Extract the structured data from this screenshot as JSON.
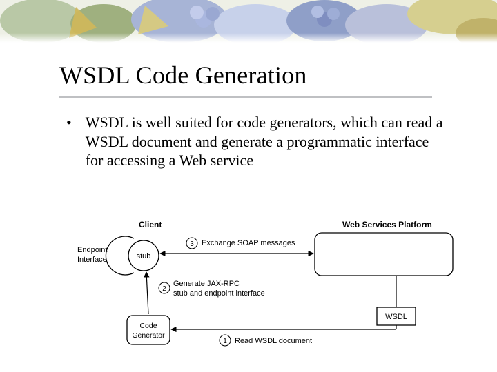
{
  "slide": {
    "title": "WSDL Code Generation",
    "bullet": "WSDL is well suited for code generators, which can read a WSDL document and generate a programmatic interface for accessing a Web service"
  },
  "diagram": {
    "client_label": "Client",
    "platform_label": "Web Services Platform",
    "endpoint_interface": "Endpoint\nInterface",
    "stub_label": "stub",
    "code_generator": "Code\nGenerator",
    "wsdl_box": "WSDL",
    "step1": "Read WSDL document",
    "step2": "Generate JAX-RPC\nstub and endpoint interface",
    "step3": "Exchange SOAP messages",
    "num1": "1",
    "num2": "2",
    "num3": "3"
  }
}
